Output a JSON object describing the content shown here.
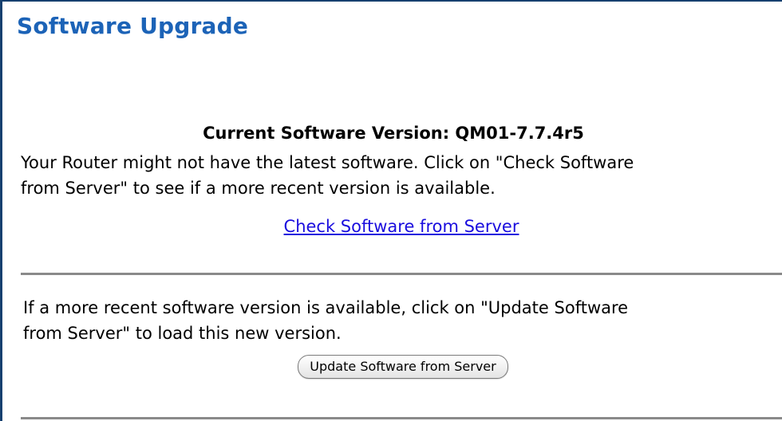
{
  "page": {
    "title": "Software Upgrade"
  },
  "version": {
    "label": "Current Software Version: QM01-7.7.4r5"
  },
  "check_section": {
    "line1": "Your Router might not have the latest software. Click on \"Check Software",
    "line2": "from Server\" to see if a more recent version is available.",
    "link_label": " Check Software from Server "
  },
  "update_section": {
    "line1": "If a more recent software version is available, click on \"Update Software",
    "line2": "from Server\" to load this new version.",
    "button_label": "Update Software from Server"
  },
  "colors": {
    "title": "#1c63b7",
    "link": "#1a0dde",
    "frame_border": "#16406f",
    "divider": "#8a8a8a"
  }
}
